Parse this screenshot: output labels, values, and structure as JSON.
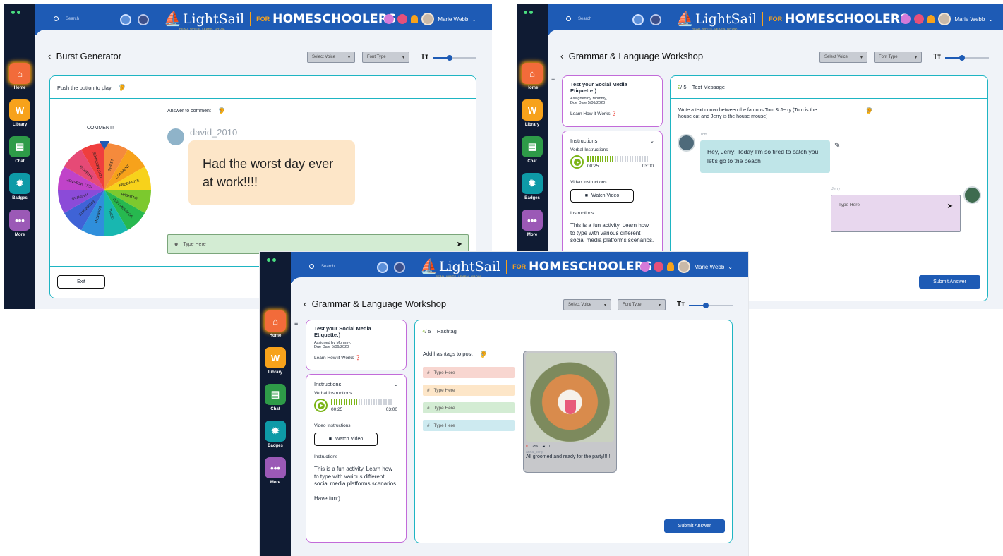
{
  "common": {
    "search_placeholder": "Search",
    "brand": "LightSail",
    "tagline": "READ. WRITE. LEARN. GROW.",
    "for": "FOR",
    "homeschoolers": "HOMESCHOOLERS",
    "user_name": "Marie Webb",
    "nav": [
      {
        "label": "Home",
        "icon": "home-icon",
        "glyph": "⌂"
      },
      {
        "label": "Library",
        "icon": "library-icon",
        "glyph": "W"
      },
      {
        "label": "Chat",
        "icon": "chat-icon",
        "glyph": "▤"
      },
      {
        "label": "Badges",
        "icon": "badge-icon",
        "glyph": "✹"
      },
      {
        "label": "More",
        "icon": "more-icon",
        "glyph": "•••"
      }
    ],
    "select_voice": "Select Voice",
    "font_type": "Font Type",
    "tt": "Tт",
    "submit": "Submit Answer"
  },
  "burst": {
    "title": "Burst Generator",
    "push": "Push the button to play",
    "wheel_title": "COMMENT!",
    "wheel_segments": [
      {
        "label": "TWEET",
        "color": "#f58a3c"
      },
      {
        "label": "COMMENT",
        "color": "#f7a21b"
      },
      {
        "label": "FREEWRITE",
        "color": "#f7d21b"
      },
      {
        "label": "HASHTAG",
        "color": "#7cc92e"
      },
      {
        "label": "TEXT MESSAGE",
        "color": "#27b84f"
      },
      {
        "label": "TWEET",
        "color": "#18b7b0"
      },
      {
        "label": "COMMENT",
        "color": "#2f8fdc"
      },
      {
        "label": "FREEWRITE",
        "color": "#3f63d6"
      },
      {
        "label": "HASHTAG",
        "color": "#8b4bd8"
      },
      {
        "label": "TEXT MESSAGE",
        "color": "#c043c9"
      },
      {
        "label": "HASHTAG",
        "color": "#e64a76"
      },
      {
        "label": "TEXT MESSAGE",
        "color": "#ef3e3e"
      }
    ],
    "answer_to": "Answer to comment",
    "username": "david_2010",
    "comment": "Had the worst day ever at work!!!!",
    "type_here": "Type Here",
    "exit": "Exit"
  },
  "grammar": {
    "title": "Grammar & Language Workshop",
    "assignment_title": "Test your Social Media Etiquette:)",
    "assigned_by": "Assigned by Mommy,",
    "due": "Due Date 5/06/2020",
    "learn": "Learn How it Works",
    "instructions_header": "Instructions",
    "verbal": "Verbal Instructions",
    "time_start": "00:25",
    "time_end": "03:00",
    "video": "Video Instructions",
    "watch": "Watch Video",
    "instructions_label": "Instructions",
    "instructions_text": "This is a fun activity. Learn how to type with various different social media platforms scenarios.",
    "have_fun": "Have fun:)"
  },
  "text_msg": {
    "step_current": "2",
    "step_total": "/ 5",
    "step_name": "Text Message",
    "prompt": "Write a text convo between the famous Tom & Jerry (Tom is the house cat and Jerry is the house mouse)",
    "tom": "Tom",
    "tom_msg": "Hey, Jerry! Today I'm so tired to catch you, let's go to the beach",
    "jerry": "Jerry",
    "type_here": "Type Here"
  },
  "hashtag": {
    "step_current": "4",
    "step_total": "/ 5",
    "step_name": "Hashtag",
    "prompt": "Add hashtags to post",
    "inputs": [
      {
        "placeholder": "Type Here",
        "color": "#f8d6d0"
      },
      {
        "placeholder": "Type Here",
        "color": "#fde6c8"
      },
      {
        "placeholder": "Type Here",
        "color": "#d3ecd3"
      },
      {
        "placeholder": "Type Here",
        "color": "#cdeaf0"
      }
    ],
    "likes": "256",
    "comments": "0",
    "post_user": "anna_corg",
    "caption": "All groomed and ready for the party!!!!!"
  }
}
